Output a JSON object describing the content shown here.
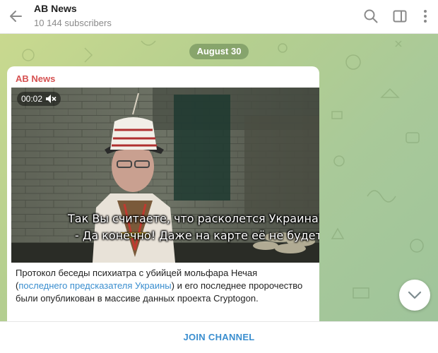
{
  "header": {
    "title": "AB News",
    "subscribers": "10 144 subscribers"
  },
  "chat": {
    "date_label": "August 30"
  },
  "message": {
    "sender": "AB News",
    "video": {
      "time": "00:02",
      "subtitle_line1": "Так Вы считаете, что расколется Украина?",
      "subtitle_line2": "- Да конечно! Даже на карте её не будет!"
    },
    "caption_part1": "Протокол беседы психиатра с убийцей мольфара Нечая (",
    "caption_link": "последнего предсказателя Украины",
    "caption_part2": ") и его последнее пророчество были опубликован в массиве данных проекта Cryptogon."
  },
  "footer": {
    "join_label": "JOIN CHANNEL"
  },
  "colors": {
    "accent": "#3a8ecf",
    "sender": "#d65151",
    "chat_bg": "#b5cf8f"
  }
}
